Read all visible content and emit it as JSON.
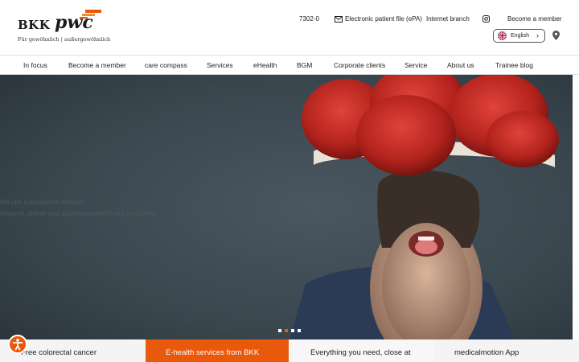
{
  "brand": {
    "name_bkk": "BKK",
    "name_pwc": "pwc",
    "tagline": "Für gewöhnlich | außergewöhnlich"
  },
  "utility": {
    "phone": "7302-0",
    "epa": "Electronic patient file (ePA)",
    "branch": "Internet branch",
    "become_member": "Become a member",
    "language": "English"
  },
  "nav": {
    "items": [
      {
        "label": "In focus"
      },
      {
        "label": "Become a member"
      },
      {
        "label": "care compass"
      },
      {
        "label": "Services"
      },
      {
        "label": "eHealth"
      },
      {
        "label": "BGM"
      },
      {
        "label": "Corporate clients"
      },
      {
        "label": "Service"
      },
      {
        "label": "About us"
      },
      {
        "label": "Trainee blog"
      }
    ]
  },
  "hero": {
    "overlay_line1": "Mit uns Gesundheit erleben",
    "overlay_line2": "Gesund, sicher und außergewöhnlich gut versichert"
  },
  "cards": [
    {
      "title": "Free colorectal cancer"
    },
    {
      "title": "E-health services from BKK"
    },
    {
      "title": "Everything you need, close at"
    },
    {
      "title": "medicalmotion App"
    }
  ],
  "colors": {
    "accent": "#e8590c",
    "text": "#222222",
    "hero_bg": "#3d4a52"
  }
}
